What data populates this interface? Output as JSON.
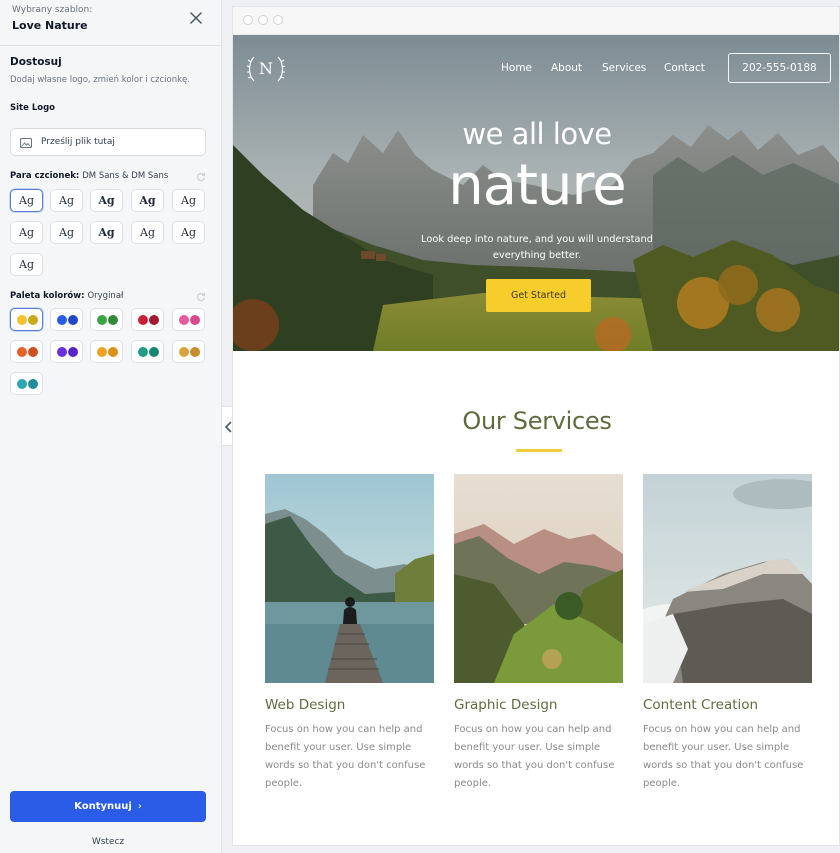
{
  "sidebar": {
    "selected_label": "Wybrany szablon:",
    "template_name": "Love Nature",
    "section_title": "Dostosuj",
    "section_subtitle": "Dodaj własne logo, zmień kolor i czcionkę.",
    "logo_label": "Site Logo",
    "upload_label": "Prześlij plik tutaj",
    "font_pair_label": "Para czcionek:",
    "font_pair_value": "DM Sans & DM Sans",
    "font_tile_text": "Ag",
    "palette_label": "Paleta kolorów:",
    "palette_value": "Oryginał",
    "palettes": [
      [
        "#f2c230",
        "#c9a91e"
      ],
      [
        "#2a5ce8",
        "#1f49c9"
      ],
      [
        "#3aa345",
        "#2f8a39"
      ],
      [
        "#c8203b",
        "#a11a2f"
      ],
      [
        "#e85a9c",
        "#d94b8d"
      ],
      [
        "#e8632a",
        "#d04f1e"
      ],
      [
        "#6a2ee0",
        "#5623c4"
      ],
      [
        "#f0a225",
        "#e08f16"
      ],
      [
        "#1f9e84",
        "#168572"
      ],
      [
        "#d9a33f",
        "#c98b2e"
      ],
      [
        "#2aa7b0",
        "#208f97"
      ]
    ],
    "continue_label": "Kontynuuj",
    "back_label": "Wstecz"
  },
  "preview": {
    "logo_letter": "N",
    "nav": [
      "Home",
      "About",
      "Services",
      "Contact"
    ],
    "phone": "202-555-0188",
    "hero_line1": "we all love",
    "hero_line2": "nature",
    "hero_desc": "Look deep into nature, and you will understand everything better.",
    "cta_label": "Get Started",
    "services_title": "Our Services",
    "cards": [
      {
        "title": "Web Design",
        "text": "Focus on how you can help and benefit your user. Use simple words so that you don't confuse people."
      },
      {
        "title": "Graphic Design",
        "text": "Focus on how you can help and benefit your user. Use simple words so that you don't confuse people."
      },
      {
        "title": "Content Creation",
        "text": "Focus on how you can help and benefit your user. Use simple words so that you don't confuse people."
      }
    ]
  }
}
